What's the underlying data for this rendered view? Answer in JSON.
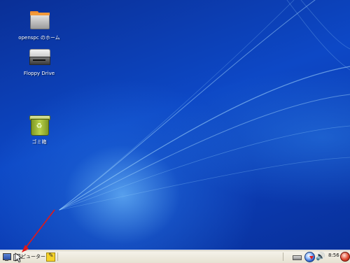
{
  "desktop": {
    "icons": [
      {
        "label": "openspc のホーム",
        "icon": "home-folder-icon"
      },
      {
        "label": "Floppy Drive",
        "icon": "floppy-drive-icon"
      },
      {
        "label": "ゴミ箱",
        "icon": "trash-icon"
      }
    ]
  },
  "taskbar": {
    "show_desktop_icon": "show-desktop-icon",
    "computer_label": "ピューター",
    "notes_icon": "notes-icon",
    "tray": {
      "network_icon": "network-icon",
      "update_icon": "update-icon",
      "volume_icon": "volume-icon",
      "clock": "8:56",
      "power_icon": "power-icon"
    }
  },
  "colors": {
    "wallpaper": "#0b3fb0",
    "taskbar": "#efece0",
    "arrow": "#e01818"
  }
}
